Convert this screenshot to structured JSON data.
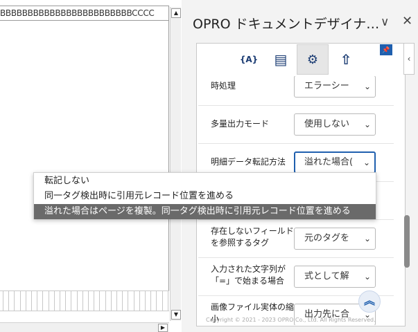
{
  "sheet": {
    "column_header_text": "BBBBBBBBBBBBBBBBBBBBBBBBCCCC",
    "scroll_up_glyph": "▲",
    "scroll_down_glyph": "▼",
    "scroll_right_glyph": "▶"
  },
  "panel": {
    "title": "OPRO ドキュメントデザイナ…",
    "chevron_glyph": "∨",
    "close_glyph": "✕",
    "collapse_glyph": "‹",
    "pin_glyph": "📌",
    "toolbar": [
      {
        "icon": "braces-a-icon",
        "glyph": "{A}"
      },
      {
        "icon": "table-icon",
        "glyph": "▤"
      },
      {
        "icon": "gear-icon",
        "glyph": "⚙"
      },
      {
        "icon": "upload-icon",
        "glyph": "⇧"
      }
    ],
    "properties": [
      {
        "label": "時処理",
        "value": "エラーシー"
      },
      {
        "label": "多量出力モード",
        "value": "使用しない"
      },
      {
        "label": "明細データ転記方法",
        "value": "溢れた場合("
      },
      {
        "label": "",
        "value": ""
      },
      {
        "label": "存在しないフィールドを参照するタグ",
        "value": "元のタグを"
      },
      {
        "label": "入力された文字列が「=」で始まる場合",
        "value": "式として解"
      },
      {
        "label": "画像ファイル実体の縮小",
        "value": "出力先に合"
      }
    ],
    "fab_glyph": "︽",
    "copyright": "Copyright © 2021 - 2023 OPRO Co., Ltd. All Rights Reserved."
  },
  "dropdown": {
    "options": [
      "転記しない",
      "同一タグ検出時に引用元レコード位置を進める",
      "溢れた場合はページを複製。同一タグ検出時に引用元レコード位置を進める"
    ],
    "selected_index": 2
  },
  "colors": {
    "accent": "#1f5fae",
    "selected_option_bg": "#6a6a6a"
  }
}
